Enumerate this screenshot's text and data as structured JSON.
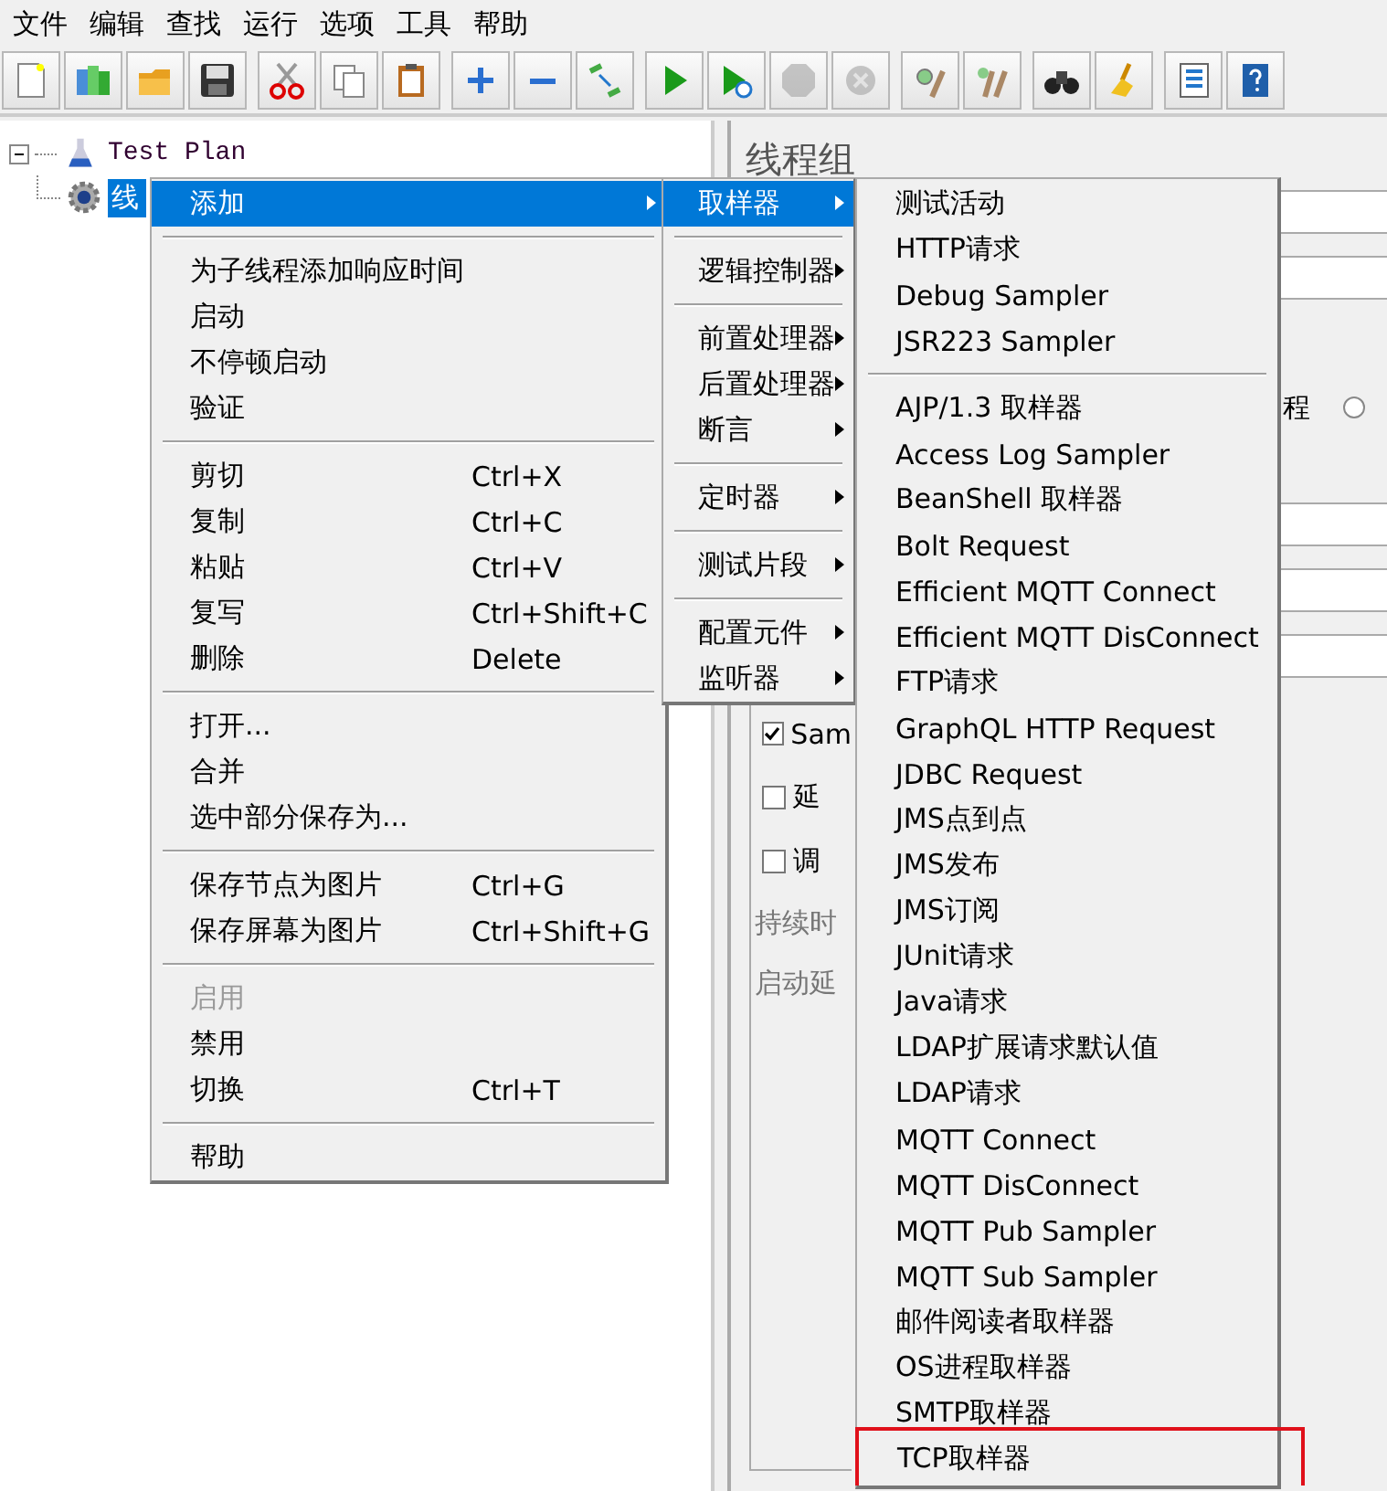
{
  "menu_bar": [
    "文件",
    "编辑",
    "查找",
    "运行",
    "选项",
    "工具",
    "帮助"
  ],
  "toolbar": [
    {
      "disabled": false
    },
    {
      "disabled": false
    },
    {
      "disabled": false
    },
    {
      "disabled": false
    },
    {
      "disabled": false
    },
    {
      "disabled": false
    },
    {
      "disabled": false
    },
    {
      "disabled": false
    },
    {
      "disabled": false
    },
    {
      "disabled": false
    },
    {
      "disabled": false
    },
    {
      "disabled": false
    },
    {
      "disabled": true
    },
    {
      "disabled": true
    },
    {
      "disabled": false
    },
    {
      "disabled": false
    },
    {
      "disabled": false
    },
    {
      "disabled": false
    },
    {
      "disabled": false
    },
    {
      "disabled": false
    }
  ],
  "tree": [
    {
      "label": "Test Plan",
      "expanded": true,
      "selected": false,
      "children": [
        {
          "label": "线",
          "selected": true
        }
      ]
    }
  ],
  "panel": {
    "title": "线程组",
    "partial_label": "程",
    "radio_selected": false,
    "checkboxes": [
      {
        "label": "Sam",
        "checked": true
      },
      {
        "label": "延",
        "checked": false
      },
      {
        "label": "调",
        "checked": false
      }
    ],
    "labels": [
      {
        "text": "持续时",
        "disabled": true
      },
      {
        "text": "启动延",
        "disabled": true
      }
    ]
  },
  "menus": [
    {
      "items": [
        {
          "kind": "item",
          "label": "添加",
          "submenu": true,
          "selected": true,
          "disabled": false
        },
        {
          "kind": "separator"
        },
        {
          "kind": "item",
          "label": "为子线程添加响应时间",
          "submenu": false,
          "selected": false,
          "disabled": false
        },
        {
          "kind": "item",
          "label": "启动",
          "submenu": false,
          "selected": false,
          "disabled": false
        },
        {
          "kind": "item",
          "label": "不停顿启动",
          "submenu": false,
          "selected": false,
          "disabled": false
        },
        {
          "kind": "item",
          "label": "验证",
          "submenu": false,
          "selected": false,
          "disabled": false
        },
        {
          "kind": "separator"
        },
        {
          "kind": "item",
          "label": "剪切",
          "shortcut": "Ctrl+X",
          "submenu": false,
          "selected": false,
          "disabled": false
        },
        {
          "kind": "item",
          "label": "复制",
          "shortcut": "Ctrl+C",
          "submenu": false,
          "selected": false,
          "disabled": false
        },
        {
          "kind": "item",
          "label": "粘贴",
          "shortcut": "Ctrl+V",
          "submenu": false,
          "selected": false,
          "disabled": false
        },
        {
          "kind": "item",
          "label": "复写",
          "shortcut": "Ctrl+Shift+C",
          "submenu": false,
          "selected": false,
          "disabled": false
        },
        {
          "kind": "item",
          "label": "删除",
          "shortcut": "Delete",
          "submenu": false,
          "selected": false,
          "disabled": false
        },
        {
          "kind": "separator"
        },
        {
          "kind": "item",
          "label": "打开...",
          "submenu": false,
          "selected": false,
          "disabled": false
        },
        {
          "kind": "item",
          "label": "合并",
          "submenu": false,
          "selected": false,
          "disabled": false
        },
        {
          "kind": "item",
          "label": "选中部分保存为...",
          "submenu": false,
          "selected": false,
          "disabled": false
        },
        {
          "kind": "separator"
        },
        {
          "kind": "item",
          "label": "保存节点为图片",
          "shortcut": "Ctrl+G",
          "submenu": false,
          "selected": false,
          "disabled": false
        },
        {
          "kind": "item",
          "label": "保存屏幕为图片",
          "shortcut": "Ctrl+Shift+G",
          "submenu": false,
          "selected": false,
          "disabled": false
        },
        {
          "kind": "separator"
        },
        {
          "kind": "item",
          "label": "启用",
          "submenu": false,
          "selected": false,
          "disabled": true
        },
        {
          "kind": "item",
          "label": "禁用",
          "submenu": false,
          "selected": false,
          "disabled": false
        },
        {
          "kind": "item",
          "label": "切换",
          "shortcut": "Ctrl+T",
          "submenu": false,
          "selected": false,
          "disabled": false
        },
        {
          "kind": "separator"
        },
        {
          "kind": "item",
          "label": "帮助",
          "submenu": false,
          "selected": false,
          "disabled": false
        }
      ]
    },
    {
      "items": [
        {
          "kind": "item",
          "label": "取样器",
          "submenu": true,
          "selected": true
        },
        {
          "kind": "separator"
        },
        {
          "kind": "item",
          "label": "逻辑控制器",
          "submenu": true,
          "selected": false
        },
        {
          "kind": "separator"
        },
        {
          "kind": "item",
          "label": "前置处理器",
          "submenu": true,
          "selected": false
        },
        {
          "kind": "item",
          "label": "后置处理器",
          "submenu": true,
          "selected": false
        },
        {
          "kind": "item",
          "label": "断言",
          "submenu": true,
          "selected": false
        },
        {
          "kind": "separator"
        },
        {
          "kind": "item",
          "label": "定时器",
          "submenu": true,
          "selected": false
        },
        {
          "kind": "separator"
        },
        {
          "kind": "item",
          "label": "测试片段",
          "submenu": true,
          "selected": false
        },
        {
          "kind": "separator"
        },
        {
          "kind": "item",
          "label": "配置元件",
          "submenu": true,
          "selected": false
        },
        {
          "kind": "item",
          "label": "监听器",
          "submenu": true,
          "selected": false
        }
      ]
    },
    {
      "items": [
        {
          "kind": "item",
          "label": "测试活动",
          "selected": false,
          "boxed": false
        },
        {
          "kind": "item",
          "label": "HTTP请求",
          "selected": false,
          "boxed": false
        },
        {
          "kind": "item",
          "label": "Debug Sampler",
          "selected": false,
          "boxed": false
        },
        {
          "kind": "item",
          "label": "JSR223 Sampler",
          "selected": false,
          "boxed": false
        },
        {
          "kind": "separator"
        },
        {
          "kind": "item",
          "label": "AJP/1.3 取样器",
          "selected": false,
          "boxed": false
        },
        {
          "kind": "item",
          "label": "Access Log Sampler",
          "selected": false,
          "boxed": false
        },
        {
          "kind": "item",
          "label": "BeanShell 取样器",
          "selected": false,
          "boxed": false
        },
        {
          "kind": "item",
          "label": "Bolt Request",
          "selected": false,
          "boxed": false
        },
        {
          "kind": "item",
          "label": "Efficient MQTT Connect",
          "selected": false,
          "boxed": false
        },
        {
          "kind": "item",
          "label": "Efficient MQTT DisConnect",
          "selected": false,
          "boxed": false
        },
        {
          "kind": "item",
          "label": "FTP请求",
          "selected": false,
          "boxed": false
        },
        {
          "kind": "item",
          "label": "GraphQL HTTP Request",
          "selected": false,
          "boxed": false
        },
        {
          "kind": "item",
          "label": "JDBC Request",
          "selected": false,
          "boxed": false
        },
        {
          "kind": "item",
          "label": "JMS点到点",
          "selected": false,
          "boxed": false
        },
        {
          "kind": "item",
          "label": "JMS发布",
          "selected": false,
          "boxed": false
        },
        {
          "kind": "item",
          "label": "JMS订阅",
          "selected": false,
          "boxed": false
        },
        {
          "kind": "item",
          "label": "JUnit请求",
          "selected": false,
          "boxed": false
        },
        {
          "kind": "item",
          "label": "Java请求",
          "selected": false,
          "boxed": false
        },
        {
          "kind": "item",
          "label": "LDAP扩展请求默认值",
          "selected": false,
          "boxed": false
        },
        {
          "kind": "item",
          "label": "LDAP请求",
          "selected": false,
          "boxed": false
        },
        {
          "kind": "item",
          "label": "MQTT Connect",
          "selected": false,
          "boxed": false
        },
        {
          "kind": "item",
          "label": "MQTT DisConnect",
          "selected": false,
          "boxed": false
        },
        {
          "kind": "item",
          "label": "MQTT Pub Sampler",
          "selected": false,
          "boxed": false
        },
        {
          "kind": "item",
          "label": "MQTT Sub Sampler",
          "selected": false,
          "boxed": false
        },
        {
          "kind": "item",
          "label": "邮件阅读者取样器",
          "selected": false,
          "boxed": false
        },
        {
          "kind": "item",
          "label": "OS进程取样器",
          "selected": false,
          "boxed": false
        },
        {
          "kind": "item",
          "label": "SMTP取样器",
          "selected": false,
          "boxed": false
        },
        {
          "kind": "item",
          "label": "TCP取样器",
          "selected": false,
          "boxed": true
        }
      ]
    }
  ]
}
